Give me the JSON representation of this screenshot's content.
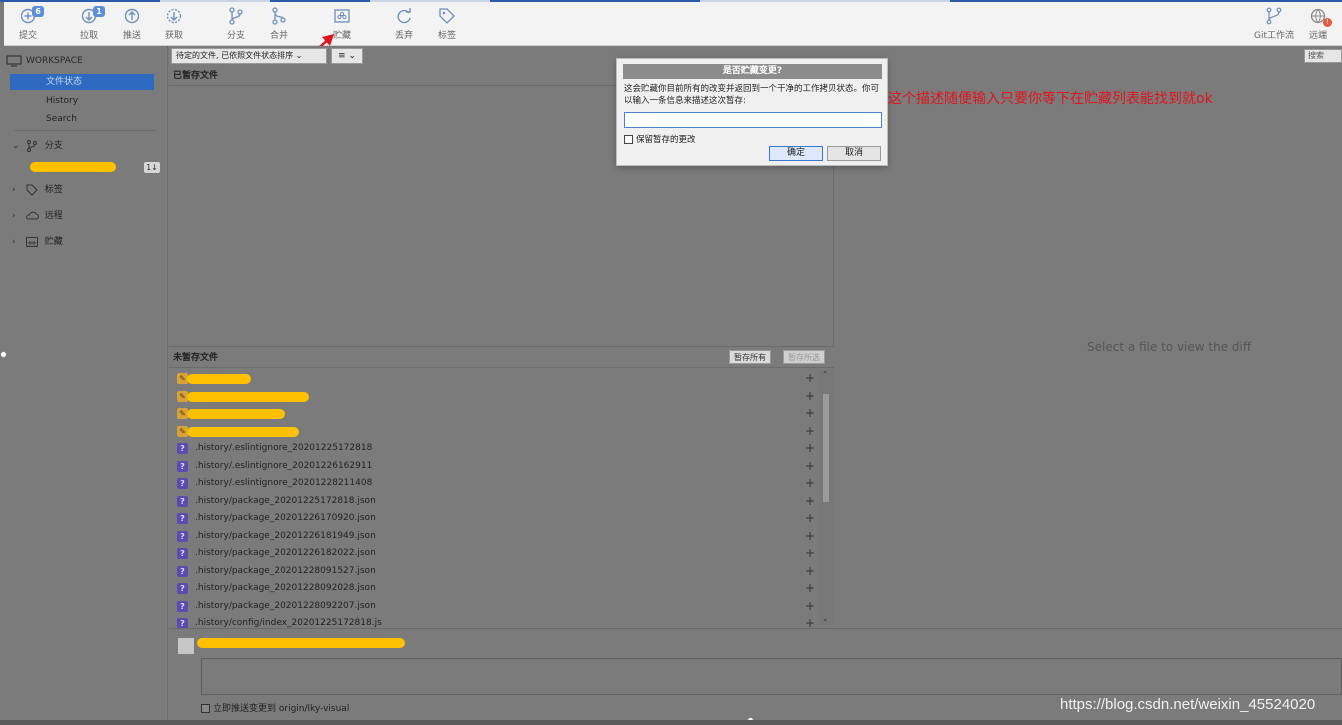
{
  "toolbar": {
    "buttons": [
      {
        "label": "提交",
        "icon": "commit-icon",
        "badge": "6"
      },
      {
        "label": "拉取",
        "icon": "pull-icon",
        "badge": "1"
      },
      {
        "label": "推送",
        "icon": "push-icon"
      },
      {
        "label": "获取",
        "icon": "fetch-icon"
      },
      {
        "label": "分支",
        "icon": "branch-icon"
      },
      {
        "label": "合并",
        "icon": "merge-icon"
      },
      {
        "label": "贮藏",
        "icon": "stash-icon"
      },
      {
        "label": "丢弃",
        "icon": "discard-icon"
      },
      {
        "label": "标签",
        "icon": "tag-icon"
      }
    ],
    "right_buttons": [
      {
        "label": "Git工作流",
        "icon": "git-flow-icon"
      },
      {
        "label": "远端",
        "icon": "remote-icon",
        "alert": "!"
      }
    ]
  },
  "sidebar": {
    "workspace_label": "WORKSPACE",
    "workspace_items": [
      "文件状态",
      "History",
      "Search"
    ],
    "selected_item": "文件状态",
    "groups": [
      {
        "label": "分支",
        "expanded": true,
        "icon": "branch-icon"
      },
      {
        "label": "标签",
        "expanded": false,
        "icon": "tag-icon"
      },
      {
        "label": "远程",
        "expanded": false,
        "icon": "cloud-icon"
      },
      {
        "label": "贮藏",
        "expanded": false,
        "icon": "stash-icon"
      }
    ],
    "branch_count": "1↓"
  },
  "filter": {
    "file_filter": "待定的文件, 已依照文件状态排序",
    "view_mode": "≡"
  },
  "staged": {
    "header": "已暂存文件"
  },
  "unstaged": {
    "header": "未暂存文件",
    "stage_all": "暂存所有",
    "stage_selected": "暂存所选",
    "files": [
      {
        "status": "modified",
        "name": ""
      },
      {
        "status": "modified",
        "name": ""
      },
      {
        "status": "modified",
        "name": ""
      },
      {
        "status": "modified",
        "name": ""
      },
      {
        "status": "untracked",
        "name": ".history/.eslintignore_20201225172818"
      },
      {
        "status": "untracked",
        "name": ".history/.eslintignore_20201226162911"
      },
      {
        "status": "untracked",
        "name": ".history/.eslintignore_20201228211408"
      },
      {
        "status": "untracked",
        "name": ".history/package_20201225172818.json"
      },
      {
        "status": "untracked",
        "name": ".history/package_20201226170920.json"
      },
      {
        "status": "untracked",
        "name": ".history/package_20201226181949.json"
      },
      {
        "status": "untracked",
        "name": ".history/package_20201226182022.json"
      },
      {
        "status": "untracked",
        "name": ".history/package_20201228091527.json"
      },
      {
        "status": "untracked",
        "name": ".history/package_20201228092028.json"
      },
      {
        "status": "untracked",
        "name": ".history/package_20201228092207.json"
      },
      {
        "status": "untracked",
        "name": ".history/config/index_20201225172818.js"
      }
    ]
  },
  "commit": {
    "push_immediately": "立即推送变更到 origin/lky-visual"
  },
  "diff": {
    "search_placeholder": "搜索",
    "empty_message": "Select a file to view the diff"
  },
  "dialog": {
    "title": "是否贮藏变更?",
    "message": "这会贮藏你目前所有的改变并返回到一个干净的工作拷贝状态。你可以输入一条信息来描述这次暂存:",
    "input_value": "",
    "keep_staged": "保留暂存的更改",
    "ok": "确定",
    "cancel": "取消"
  },
  "annotation": "这个描述随便输入只要你等下在贮藏列表能找到就ok",
  "watermark": "https://blog.csdn.net/weixin_45524020",
  "colors": {
    "accent": "#2d6ac0",
    "annotation": "#e0141e",
    "redaction": "#ffc000",
    "untracked_icon": "#5b4bb1",
    "modified_icon": "#d8a23a"
  }
}
